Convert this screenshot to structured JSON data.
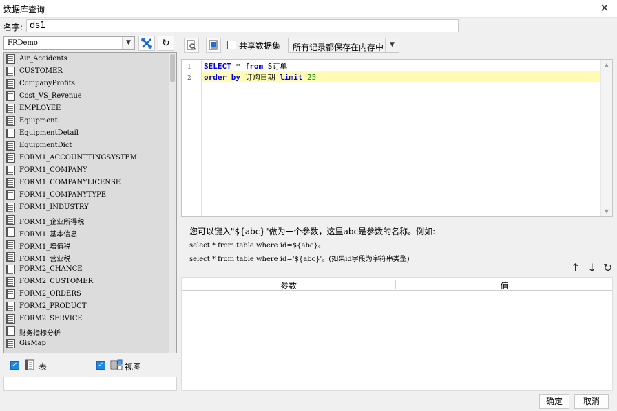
{
  "window": {
    "title": "数据库查询",
    "close": "✕"
  },
  "name_field": {
    "label": "名字:",
    "value": "ds1"
  },
  "left": {
    "connection": "FRDemo",
    "tables": [
      "Air_Accidents",
      "CUSTOMER",
      "CompanyProfits",
      "Cost_VS_Revenue",
      "EMPLOYEE",
      "Equipment",
      "EquipmentDetail",
      "EquipmentDict",
      "FORM1_ACCOUNTTINGSYSTEM",
      "FORM1_COMPANY",
      "FORM1_COMPANYLICENSE",
      "FORM1_COMPANYTYPE",
      "FORM1_INDUSTRY",
      "FORM1_企业所得税",
      "FORM1_基本信息",
      "FORM1_增值税",
      "FORM1_营业税",
      "FORM2_CHANCE",
      "FORM2_CUSTOMER",
      "FORM2_ORDERS",
      "FORM2_PRODUCT",
      "FORM2_SERVICE",
      "财务指标分析",
      "GisMap"
    ],
    "check_table": "表",
    "check_view": "视图"
  },
  "toolbar": {
    "share_label": "共享数据集",
    "mode": "所有记录都保存在内存中"
  },
  "editor": {
    "line_numbers": [
      "1",
      "2"
    ],
    "line1": {
      "kw1": "SELECT",
      "rest1": " * ",
      "kw2": "from",
      "rest2": " S订单"
    },
    "line2": {
      "kw1": "order by",
      "rest1": " 订购日期 ",
      "kw2": "limit",
      "num": " 25"
    }
  },
  "help": {
    "line1": "您可以键入\"${abc}\"做为一个参数，这里abc是参数的名称。例如:",
    "line2": "select * from table where id=${abc}。",
    "line3": "select * from table where id='${abc}'。(如果id字段为字符串类型)"
  },
  "params": {
    "col_param": "参数",
    "col_value": "值"
  },
  "buttons": {
    "ok": "确定",
    "cancel": "取消"
  }
}
